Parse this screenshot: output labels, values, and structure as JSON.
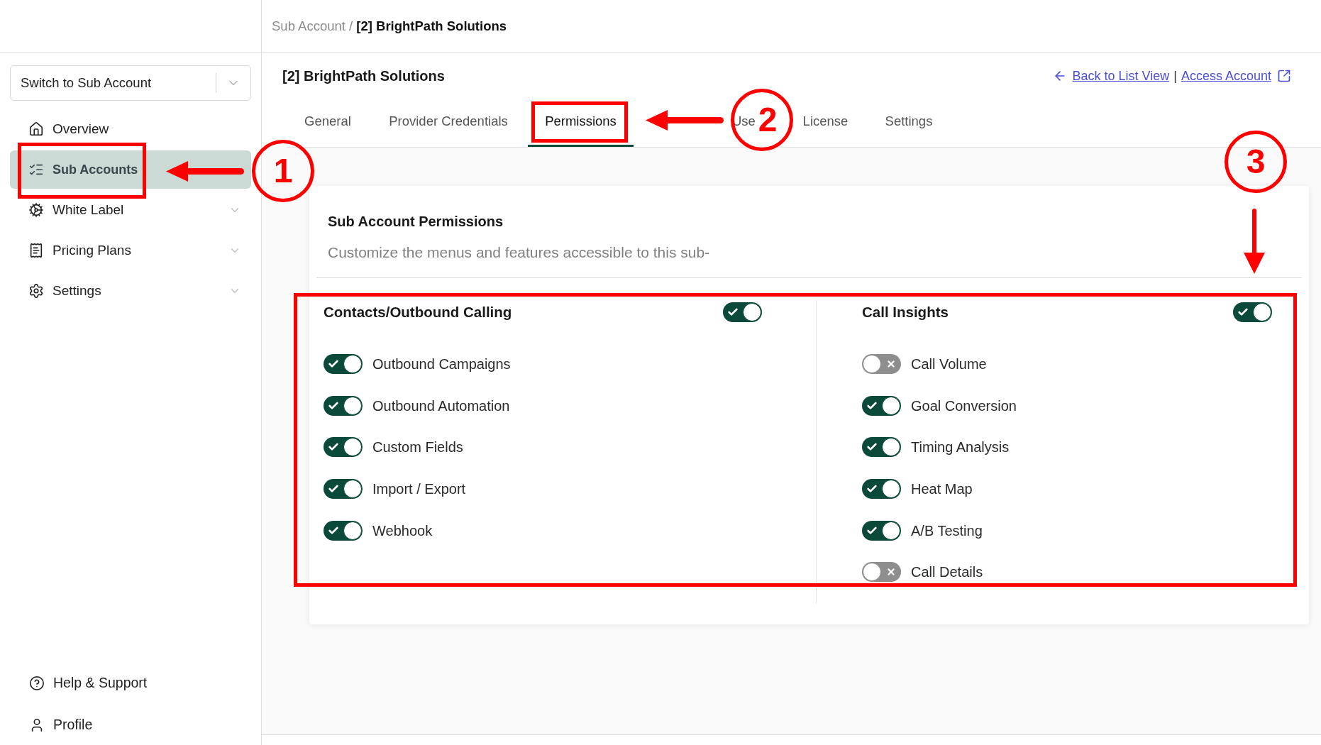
{
  "header": {
    "breadcrumb": "Sub Account / **[2] BrightPath Solutions**"
  },
  "sidebar": {
    "switcher": {
      "placeholder": "Switch to Sub Account"
    },
    "items": [
      {
        "label": "Overview",
        "selected": false,
        "expandable": false
      },
      {
        "label": "Sub Accounts",
        "selected": true,
        "expandable": false
      },
      {
        "label": "White Label",
        "selected": false,
        "expandable": true
      },
      {
        "label": "Pricing Plans",
        "selected": false,
        "expandable": true
      },
      {
        "label": "Settings",
        "selected": false,
        "expandable": true
      }
    ],
    "footer_items": [
      {
        "label": "Help & Support"
      },
      {
        "label": "Profile"
      }
    ]
  },
  "page": {
    "title": "[2] BrightPath Solutions",
    "links": [
      {
        "label": "Back to List View"
      },
      {
        "label": "Access Account"
      }
    ],
    "link_separator": "|"
  },
  "tabs": [
    {
      "label": "General",
      "selected": false
    },
    {
      "label": "Provider Credentials",
      "selected": false
    },
    {
      "label": "Permissions",
      "selected": true
    },
    {
      "label": "Use",
      "selected": false
    },
    {
      "label": "License",
      "selected": false
    },
    {
      "label": "Settings",
      "selected": false
    }
  ],
  "card": {
    "title": "Sub Account Permissions",
    "description": "Customize the menus and features accessible to this sub-",
    "sections": [
      {
        "title": "Contacts/Outbound Calling",
        "on": true,
        "items": [
          {
            "label": "Outbound Campaigns",
            "on": true
          },
          {
            "label": "Outbound Automation",
            "on": true
          },
          {
            "label": "Custom Fields",
            "on": true
          },
          {
            "label": "Import / Export",
            "on": true
          },
          {
            "label": "Webhook",
            "on": true
          }
        ]
      },
      {
        "title": "Call Insights",
        "on": true,
        "items": [
          {
            "label": "Call Volume",
            "on": false
          },
          {
            "label": "Goal Conversion",
            "on": true
          },
          {
            "label": "Timing Analysis",
            "on": true
          },
          {
            "label": "Heat Map",
            "on": true
          },
          {
            "label": "A/B Testing",
            "on": true
          },
          {
            "label": "Call Details",
            "on": false
          }
        ]
      }
    ]
  },
  "annotations": [
    {
      "number": "1"
    },
    {
      "number": "2"
    },
    {
      "number": "3"
    }
  ]
}
